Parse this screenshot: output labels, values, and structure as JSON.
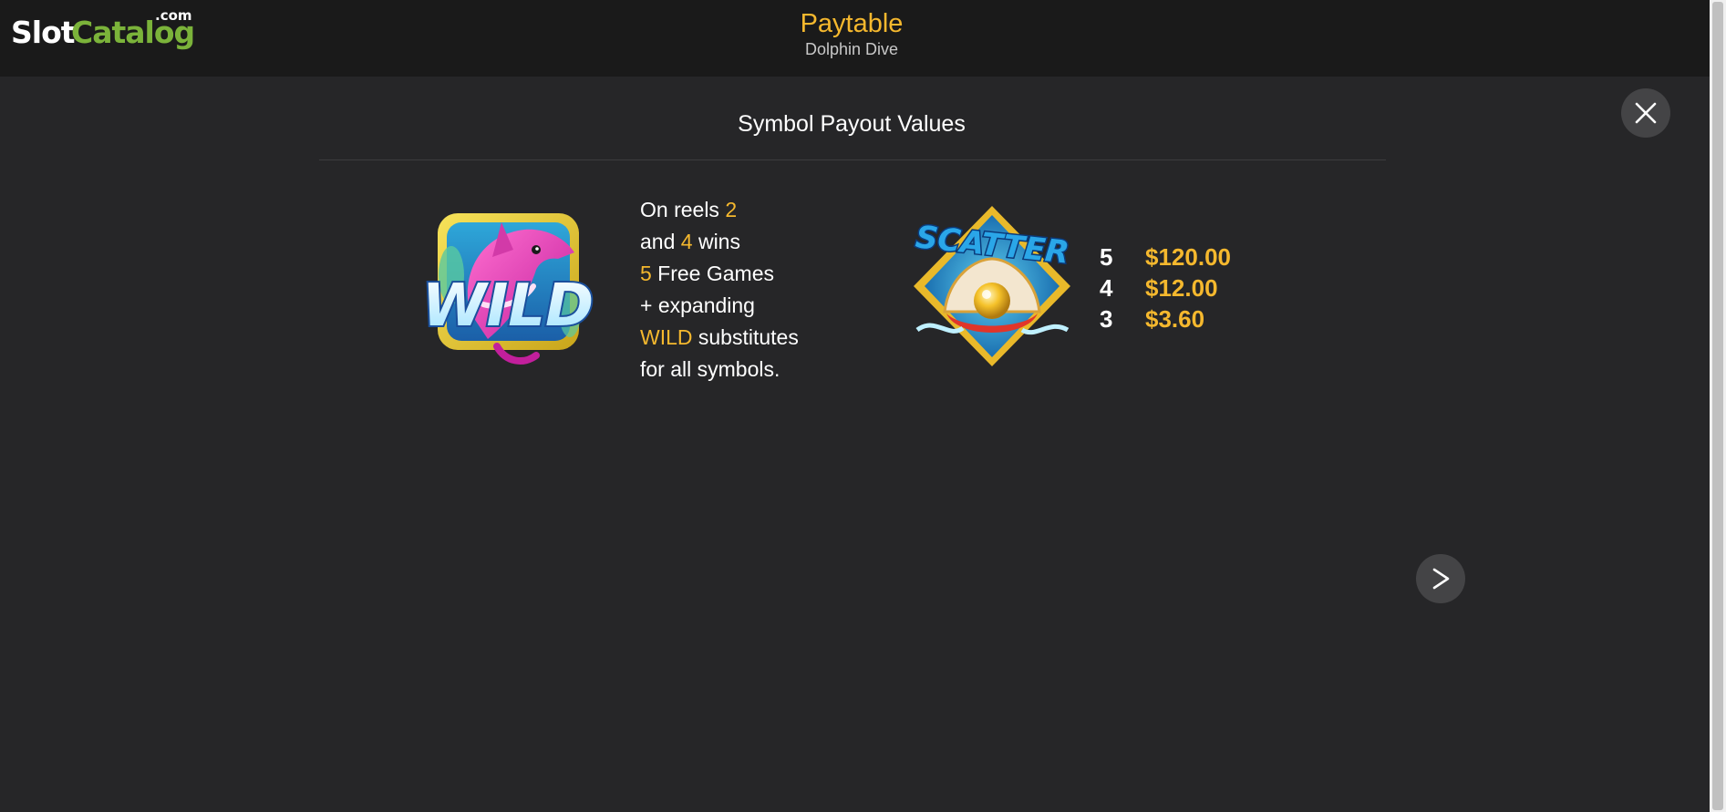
{
  "logo": {
    "part1": "Slot",
    "part2": "Catalog",
    "suffix": ".com"
  },
  "header": {
    "title": "Paytable",
    "subtitle": "Dolphin Dive"
  },
  "section": {
    "title": "Symbol Payout Values"
  },
  "wild": {
    "label": "WILD",
    "description": {
      "l1a": "On reels ",
      "l1b": "2",
      "l2a": "and ",
      "l2b": "4",
      "l2c": " wins",
      "l3a": "5",
      "l3b": " Free Games",
      "l4": "+ expanding",
      "l5a": "WILD",
      "l5b": " substitutes",
      "l6": "for all symbols."
    }
  },
  "scatter": {
    "label": "SCATTER",
    "payouts": [
      {
        "count": "5",
        "amount": "$120.00"
      },
      {
        "count": "4",
        "amount": "$12.00"
      },
      {
        "count": "3",
        "amount": "$3.60"
      }
    ]
  },
  "colors": {
    "accent": "#f5b82e",
    "brand_green": "#7bb33a",
    "background": "#262628",
    "topbar": "#1a1a1a"
  },
  "icons": {
    "close": "close-icon",
    "next": "chevron-right-icon"
  }
}
